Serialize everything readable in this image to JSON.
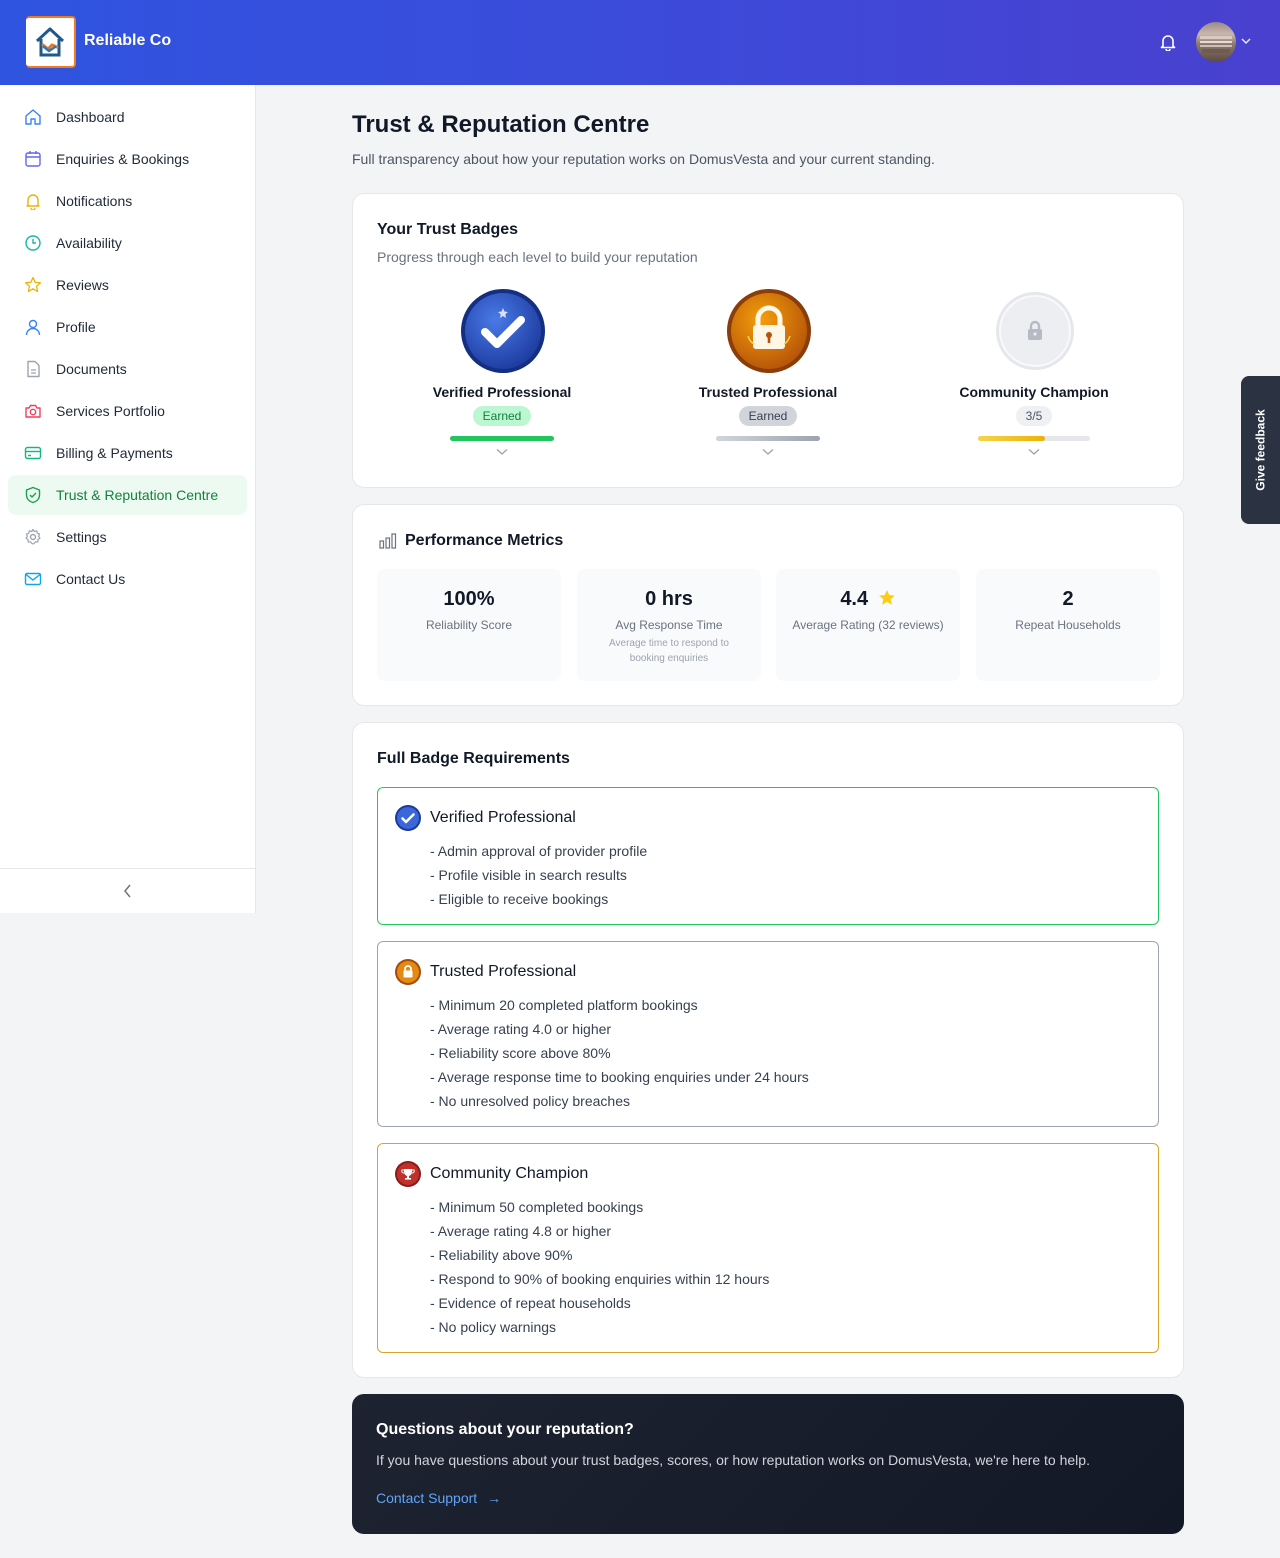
{
  "header": {
    "brand": "Reliable Co",
    "notification_icon": "bell-icon",
    "user_menu_icon": "chevron-down-icon"
  },
  "sidebar": {
    "items": [
      {
        "label": "Dashboard",
        "icon": "home-icon"
      },
      {
        "label": "Enquiries & Bookings",
        "icon": "calendar-icon"
      },
      {
        "label": "Notifications",
        "icon": "bell-icon"
      },
      {
        "label": "Availability",
        "icon": "clock-icon"
      },
      {
        "label": "Reviews",
        "icon": "star-icon"
      },
      {
        "label": "Profile",
        "icon": "user-icon"
      },
      {
        "label": "Documents",
        "icon": "document-icon"
      },
      {
        "label": "Services Portfolio",
        "icon": "camera-icon"
      },
      {
        "label": "Billing & Payments",
        "icon": "credit-card-icon"
      },
      {
        "label": "Trust & Reputation Centre",
        "icon": "shield-check-icon",
        "active": true
      },
      {
        "label": "Settings",
        "icon": "gear-icon"
      },
      {
        "label": "Contact Us",
        "icon": "mail-icon"
      }
    ],
    "collapse_icon": "chevron-left-icon"
  },
  "page": {
    "title": "Trust & Reputation Centre",
    "subtitle": "Full transparency about how your reputation works on DomusVesta and your current standing."
  },
  "badges": {
    "title": "Your Trust Badges",
    "subtitle": "Progress through each level to build your reputation",
    "items": [
      {
        "name": "Verified Professional",
        "status": "Earned",
        "progress": 1.0,
        "color": "#22c55e",
        "icon": "verified-check-badge-icon"
      },
      {
        "name": "Trusted Professional",
        "status": "Earned",
        "progress": 1.0,
        "color": "#9ca3af",
        "icon": "padlock-badge-icon"
      },
      {
        "name": "Community Champion",
        "status": "3/5",
        "progress": 0.6,
        "color": "#eab308",
        "icon": "locked-badge-icon"
      }
    ]
  },
  "metrics": {
    "title": "Performance Metrics",
    "icon": "bar-chart-icon",
    "items": [
      {
        "value": "100%",
        "label": "Reliability Score",
        "note": ""
      },
      {
        "value": "0 hrs",
        "label": "Avg Response Time",
        "note": "Average time to respond to booking enquiries"
      },
      {
        "value": "4.4",
        "label": "Average Rating (32 reviews)",
        "note": "",
        "icon": "star-icon"
      },
      {
        "value": "2",
        "label": "Repeat Households",
        "note": ""
      }
    ]
  },
  "requirements": {
    "title": "Full Badge Requirements",
    "items": [
      {
        "name": "Verified Professional",
        "border": "#22c55e",
        "lines": [
          "- Admin approval of provider profile",
          "- Profile visible in search results",
          "- Eligible to receive bookings"
        ]
      },
      {
        "name": "Trusted Professional",
        "border": "#9ca3af",
        "lines": [
          "- Minimum 20 completed platform bookings",
          "- Average rating 4.0 or higher",
          "- Reliability score above 80%",
          "- Average response time to booking enquiries under 24 hours",
          "- No unresolved policy breaches"
        ]
      },
      {
        "name": "Community Champion",
        "border": "#d4a52a",
        "lines": [
          "- Minimum 50 completed bookings",
          "- Average rating 4.8 or higher",
          "- Reliability above 90%",
          "- Respond to 90% of booking enquiries within 12 hours",
          "- Evidence of repeat households",
          "- No policy warnings"
        ]
      }
    ]
  },
  "help": {
    "title": "Questions about your reputation?",
    "text": "If you have questions about your trust badges, scores, or how reputation works on DomusVesta, we're here to help.",
    "link": "Contact Support",
    "arrow": "→"
  },
  "feedback": {
    "label": "Give feedback"
  }
}
